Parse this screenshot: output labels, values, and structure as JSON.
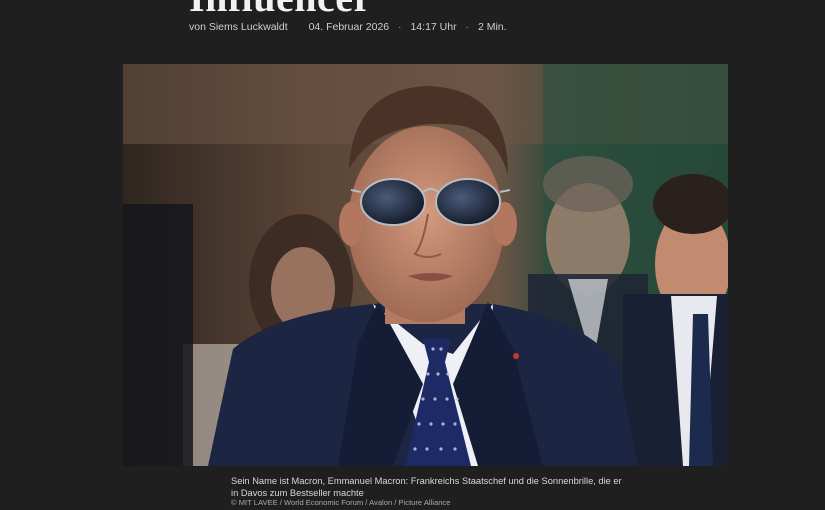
{
  "article": {
    "headline": "Influencer",
    "author": "von Siems Luckwaldt",
    "date": "04. Februar 2026",
    "time": "14:17 Uhr",
    "reading_time": "2 Min.",
    "separator": "·"
  },
  "image": {
    "subject": "man in sunglasses and navy suit, crowd behind",
    "caption": "Sein Name ist Macron, Emmanuel Macron: Frankreichs Staatschef und die Sonnenbrille, die er in Davos zum Bestseller machte",
    "credit": "© MIT LAVEE / World Economic Forum / Avalon / Picture Alliance"
  }
}
